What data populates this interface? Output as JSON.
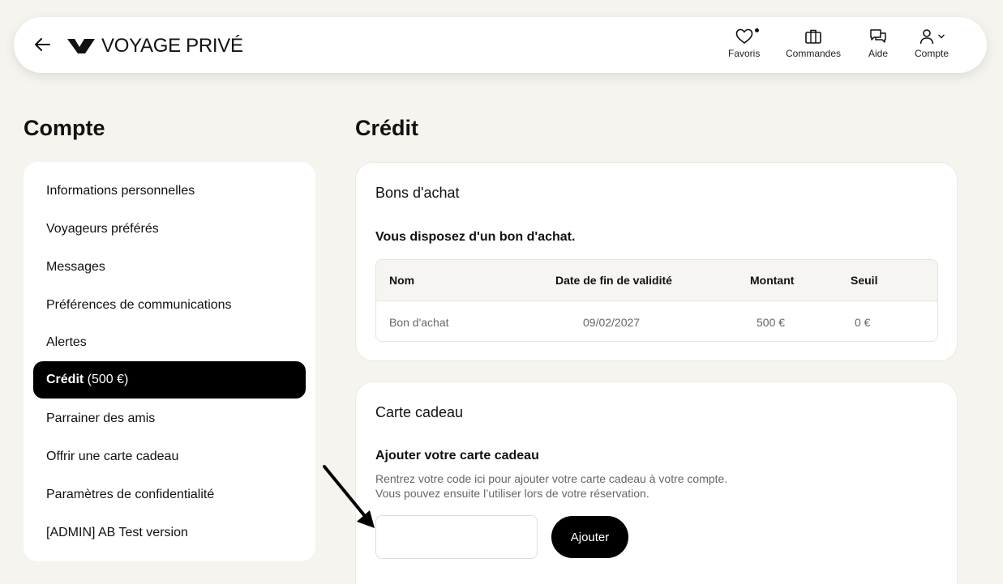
{
  "header": {
    "brand": "VOYAGE PRIVÉ",
    "nav": {
      "favoris": "Favoris",
      "commandes": "Commandes",
      "aide": "Aide",
      "compte": "Compte"
    }
  },
  "sidebar": {
    "title": "Compte",
    "items": [
      {
        "label": "Informations personnelles"
      },
      {
        "label": "Voyageurs préférés"
      },
      {
        "label": "Messages"
      },
      {
        "label": "Préférences de communications"
      },
      {
        "label": "Alertes"
      },
      {
        "label": "Crédit",
        "suffix": " (500 €)",
        "active": true
      },
      {
        "label": "Parrainer des amis"
      },
      {
        "label": "Offrir une carte cadeau"
      },
      {
        "label": "Paramètres de confidentialité"
      },
      {
        "label": "[ADMIN] AB Test version"
      }
    ]
  },
  "main": {
    "title": "Crédit",
    "vouchers": {
      "title": "Bons d'achat",
      "subtitle": "Vous disposez d'un bon d'achat.",
      "columns": [
        "Nom",
        "Date de fin de validité",
        "Montant",
        "Seuil"
      ],
      "rows": [
        [
          "Bon d'achat",
          "09/02/2027",
          "500 €",
          "0 €"
        ]
      ]
    },
    "giftcard": {
      "title": "Carte cadeau",
      "subtitle": "Ajouter votre carte cadeau",
      "helper_line1": "Rentrez votre code ici pour ajouter votre carte cadeau à votre compte.",
      "helper_line2": "Vous pouvez ensuite l’utiliser lors de votre réservation.",
      "input_value": "",
      "button_label": "Ajouter"
    }
  },
  "colors": {
    "background": "#f6f4ef",
    "accent": "#000000",
    "card": "#ffffff"
  }
}
